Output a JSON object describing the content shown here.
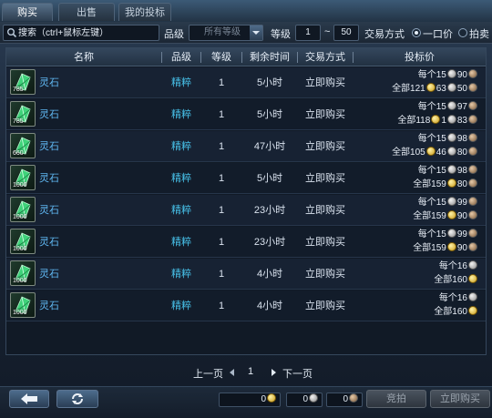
{
  "tabs": [
    {
      "label": "购买"
    },
    {
      "label": "出售"
    },
    {
      "label": "我的投标"
    }
  ],
  "filter": {
    "search_placeholder": "搜索（ctrl+鼠标左键）",
    "grade_label": "品级",
    "grade_value": "所有等级",
    "level_label": "等级",
    "level_min": "1",
    "level_sep": "~",
    "level_max": "50",
    "trade_label": "交易方式",
    "option_fixed": "一口价",
    "option_auction": "拍卖",
    "selected": "一口价"
  },
  "columns": {
    "name": "名称",
    "grade": "品级",
    "level": "等级",
    "time": "剩余时间",
    "trade": "交易方式",
    "bid": "投标价"
  },
  "rows": [
    {
      "count": "785",
      "name": "灵石",
      "grade": "精粹",
      "level": "1",
      "time": "5小时",
      "trade": "立即购买",
      "each_label": "每个15",
      "each_silver": "90",
      "total_label": "全部121",
      "total_gold": "63",
      "total_silver": "50"
    },
    {
      "count": "785",
      "name": "灵石",
      "grade": "精粹",
      "level": "1",
      "time": "5小时",
      "trade": "立即购买",
      "each_label": "每个15",
      "each_silver": "97",
      "total_label": "全部118",
      "total_gold": "1",
      "total_silver": "83"
    },
    {
      "count": "660",
      "name": "灵石",
      "grade": "精粹",
      "level": "1",
      "time": "47小时",
      "trade": "立即购买",
      "each_label": "每个15",
      "each_silver": "98",
      "total_label": "全部105",
      "total_gold": "46",
      "total_silver": "80"
    },
    {
      "count": "1000",
      "name": "灵石",
      "grade": "精粹",
      "level": "1",
      "time": "5小时",
      "trade": "立即购买",
      "each_label": "每个15",
      "each_silver": "98",
      "total_label": "全部159",
      "total_gold": "",
      "total_silver": "80"
    },
    {
      "count": "1000",
      "name": "灵石",
      "grade": "精粹",
      "level": "1",
      "time": "23小时",
      "trade": "立即购买",
      "each_label": "每个15",
      "each_silver": "99",
      "total_label": "全部159",
      "total_gold": "",
      "total_silver": "90"
    },
    {
      "count": "1000",
      "name": "灵石",
      "grade": "精粹",
      "level": "1",
      "time": "23小时",
      "trade": "立即购买",
      "each_label": "每个15",
      "each_silver": "99",
      "total_label": "全部159",
      "total_gold": "",
      "total_silver": "90"
    },
    {
      "count": "1000",
      "name": "灵石",
      "grade": "精粹",
      "level": "1",
      "time": "4小时",
      "trade": "立即购买",
      "each_label": "每个16",
      "each_silver": "",
      "total_label": "全部160",
      "total_gold": "",
      "total_silver": ""
    },
    {
      "count": "1000",
      "name": "灵石",
      "grade": "精粹",
      "level": "1",
      "time": "4小时",
      "trade": "立即购买",
      "each_label": "每个16",
      "each_silver": "",
      "total_label": "全部160",
      "total_gold": "",
      "total_silver": ""
    }
  ],
  "pager": {
    "prev": "上一页",
    "page": "1",
    "next": "下一页"
  },
  "bottom": {
    "gold_amount": "0",
    "silver_amount": "0",
    "copper_amount": "0",
    "bid_button": "竞拍",
    "buy_button": "立即购买"
  },
  "icons": {
    "back": "back-arrow-icon",
    "refresh": "refresh-icon",
    "search": "search-icon",
    "coin_silver": "silver-coin-icon",
    "coin_gold": "gold-coin-icon"
  },
  "colors": {
    "item_name": "#5fb6f0",
    "quality": "#47c0e8"
  }
}
